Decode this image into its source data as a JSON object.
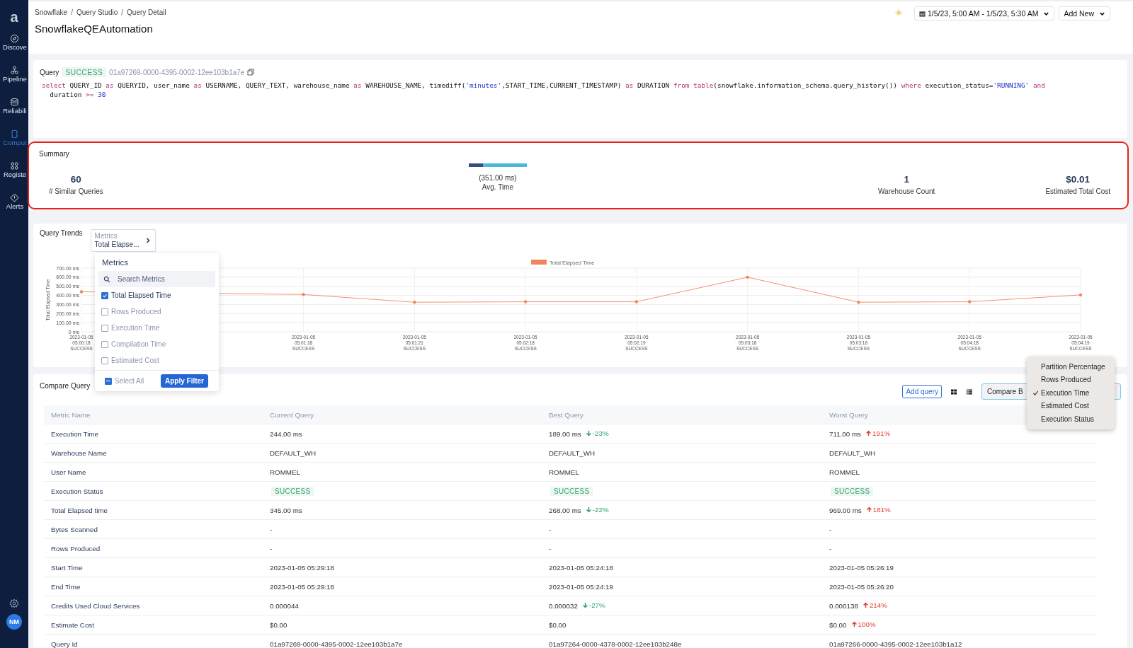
{
  "sidebar": {
    "logo": "a",
    "items": [
      {
        "label": "Discove",
        "selected": false
      },
      {
        "label": "Pipeline",
        "selected": false
      },
      {
        "label": "Reliabili",
        "selected": false
      },
      {
        "label": "Comput",
        "selected": true
      },
      {
        "label": "Registe",
        "selected": false
      },
      {
        "label": "Alerts",
        "selected": false
      }
    ],
    "avatar": "NM"
  },
  "header": {
    "breadcrumbs": [
      "Snowflake",
      "Query Studio",
      "Query Detail"
    ],
    "separator": "/",
    "title": "SnowflakeQEAutomation",
    "date_range": "1/5/23, 5:00 AM - 1/5/23, 5:30 AM",
    "add_button": "Add New"
  },
  "query": {
    "label": "Query",
    "status": "SUCCESS",
    "id": "01a97269-0000-4395-0002-12ee103b1a7e",
    "sql": [
      [
        {
          "text": "select",
          "kind": "kw"
        },
        {
          "text": " QUERY_ID ",
          "kind": "plain"
        },
        {
          "text": "as",
          "kind": "kw"
        },
        {
          "text": " QUERYID, user_name ",
          "kind": "plain"
        },
        {
          "text": "as",
          "kind": "kw"
        },
        {
          "text": " USERNAME, QUERY_TEXT, warehouse_name ",
          "kind": "plain"
        },
        {
          "text": "as",
          "kind": "kw"
        },
        {
          "text": " WAREHOUSE_NAME, timediff(",
          "kind": "plain"
        },
        {
          "text": "'minutes'",
          "kind": "str"
        },
        {
          "text": ",START_TIME,CURRENT_TIMESTAMP) ",
          "kind": "plain"
        },
        {
          "text": "as",
          "kind": "kw"
        },
        {
          "text": " DURATION ",
          "kind": "plain"
        },
        {
          "text": "from",
          "kind": "kw"
        },
        {
          "text": " table",
          "kind": "kw"
        },
        {
          "text": "(snowflake.information_schema.query_history()) ",
          "kind": "plain"
        },
        {
          "text": "where",
          "kind": "kw"
        },
        {
          "text": " execution_status=",
          "kind": "plain"
        },
        {
          "text": "'RUNNING'",
          "kind": "str"
        },
        {
          "text": " and",
          "kind": "kw"
        }
      ],
      [
        {
          "text": "  duration ",
          "kind": "plain"
        },
        {
          "text": ">=",
          "kind": "kw"
        },
        {
          "text": " 30",
          "kind": "num"
        }
      ]
    ]
  },
  "summary": {
    "title": "Summary",
    "items": [
      {
        "kind": "number",
        "value": "60",
        "label": "# Similar Queries"
      },
      {
        "kind": "bar",
        "level": 0.24,
        "value": "(351.00 ms)",
        "label": "Avg. Time"
      },
      {
        "kind": "number",
        "value": "1",
        "label": "Warehouse Count"
      },
      {
        "kind": "number",
        "value": "$0.01",
        "label": "Estimated Total Cost"
      }
    ]
  },
  "trends": {
    "title": "Query Trends",
    "metrics_button": {
      "label": "Metrics",
      "value": "Total Elapse..."
    },
    "chart_data": {
      "type": "line",
      "ylabel": "Total Elapsed Time",
      "grid": true,
      "categories": [
        "2023-01-05 05:00:18 SUCCESS",
        null,
        "2023-01-05 05:01:18 SUCCESS",
        "2023-01-05 05:01:21 SUCCESS",
        "2023-01-05 05:02:18 SUCCESS",
        "2023-01-05 05:02:19 SUCCESS",
        "2023-01-05 05:03:18 SUCCESS",
        "2023-01-05 05:03:18 SUCCESS",
        "2023-01-05 05:04:18 SUCCESS",
        "2023-01-05 05:04:19 SUCCESS"
      ],
      "series": [
        {
          "name": "Total Elapsed Time",
          "color": "#f0875a",
          "values": [
            440,
            null,
            410,
            325,
            330,
            330,
            600,
            325,
            330,
            405
          ]
        }
      ],
      "ylim": [
        0,
        700
      ],
      "yticks": [
        {
          "value": 0,
          "label": "0 ms"
        },
        {
          "value": 100,
          "label": "100.00 ms"
        },
        {
          "value": 200,
          "label": "200.00 ms"
        },
        {
          "value": 300,
          "label": "300.00 ms"
        },
        {
          "value": 400,
          "label": "400.00 ms"
        },
        {
          "value": 500,
          "label": "500.00 ms"
        },
        {
          "value": 600,
          "label": "600.00 ms"
        },
        {
          "value": 700,
          "label": "700.00 ms"
        }
      ]
    },
    "metrics_popup": {
      "title": "Metrics",
      "placeholder": "Search Metrics",
      "options": [
        {
          "label": "Total Elapsed Time",
          "checked": true
        },
        {
          "label": "Rows Produced",
          "checked": false
        },
        {
          "label": "Execution Time",
          "checked": false
        },
        {
          "label": "Compilation Time",
          "checked": false
        },
        {
          "label": "Estimated Cost",
          "checked": false
        }
      ],
      "select_all": "Select All",
      "select_all_partial": true,
      "apply": "Apply Filter"
    }
  },
  "compare": {
    "title": "Compare Query",
    "add_query": "Add query",
    "compare_by": "Compare B",
    "menu": [
      {
        "label": "Partition Percentage",
        "selected": false
      },
      {
        "label": "Rows Produced",
        "selected": false
      },
      {
        "label": "Execution Time",
        "selected": true
      },
      {
        "label": "Estimated Cost",
        "selected": false
      },
      {
        "label": "Execution Status",
        "selected": false
      }
    ],
    "columns": [
      "Metric Name",
      "Current Query",
      "Best Query",
      "Worst Query"
    ],
    "rows": [
      {
        "kind": "text",
        "cells": [
          {
            "text": "Execution Time"
          },
          {
            "text": "244.00 ms"
          },
          {
            "text": "189.00 ms",
            "delta": {
              "kind": "down",
              "text": "-23%"
            }
          },
          {
            "text": "711.00 ms",
            "delta": {
              "kind": "up",
              "text": "191%"
            }
          }
        ]
      },
      {
        "kind": "text",
        "cells": [
          {
            "text": "Warehouse Name"
          },
          {
            "text": "DEFAULT_WH"
          },
          {
            "text": "DEFAULT_WH"
          },
          {
            "text": "DEFAULT_WH"
          }
        ]
      },
      {
        "kind": "text",
        "cells": [
          {
            "text": "User Name"
          },
          {
            "text": "ROMMEL"
          },
          {
            "text": "ROMMEL"
          },
          {
            "text": "ROMMEL"
          }
        ]
      },
      {
        "kind": "status",
        "cells": [
          {
            "text": "Execution Status"
          },
          {
            "text": "SUCCESS"
          },
          {
            "text": "SUCCESS"
          },
          {
            "text": "SUCCESS"
          }
        ]
      },
      {
        "kind": "text",
        "cells": [
          {
            "text": "Total Elapsed time"
          },
          {
            "text": "345.00 ms"
          },
          {
            "text": "268.00 ms",
            "delta": {
              "kind": "down",
              "text": "-22%"
            }
          },
          {
            "text": "969.00 ms",
            "delta": {
              "kind": "up",
              "text": "181%"
            }
          }
        ]
      },
      {
        "kind": "text",
        "cells": [
          {
            "text": "Bytes Scanned"
          },
          {
            "text": "-"
          },
          {
            "text": "-"
          },
          {
            "text": "-"
          }
        ]
      },
      {
        "kind": "text",
        "cells": [
          {
            "text": "Rows Produced"
          },
          {
            "text": "-"
          },
          {
            "text": "-"
          },
          {
            "text": "-"
          }
        ]
      },
      {
        "kind": "text",
        "cells": [
          {
            "text": "Start Time"
          },
          {
            "text": "2023-01-05 05:29:18"
          },
          {
            "text": "2023-01-05 05:24:18"
          },
          {
            "text": "2023-01-05 05:26:19"
          }
        ]
      },
      {
        "kind": "text",
        "cells": [
          {
            "text": "End Time"
          },
          {
            "text": "2023-01-05 05:29:18"
          },
          {
            "text": "2023-01-05 05:24:19"
          },
          {
            "text": "2023-01-05 05:26:20"
          }
        ]
      },
      {
        "kind": "text",
        "cells": [
          {
            "text": "Credits Used Cloud Services"
          },
          {
            "text": "0.000044"
          },
          {
            "text": "0.000032",
            "delta": {
              "kind": "down",
              "text": "-27%"
            }
          },
          {
            "text": "0.000138",
            "delta": {
              "kind": "up",
              "text": "214%"
            }
          }
        ]
      },
      {
        "kind": "text",
        "cells": [
          {
            "text": "Estimate Cost"
          },
          {
            "text": "$0.00"
          },
          {
            "text": "$0.00"
          },
          {
            "text": "$0.00",
            "delta": {
              "kind": "up",
              "text": "100%"
            }
          }
        ]
      },
      {
        "kind": "text",
        "cells": [
          {
            "text": "Query Id"
          },
          {
            "text": "01a97269-0000-4395-0002-12ee103b1a7e"
          },
          {
            "text": "01a97264-0000-4378-0002-12ee103b248e"
          },
          {
            "text": "01a97266-0000-4395-0002-12ee103b1a12"
          }
        ]
      }
    ]
  }
}
